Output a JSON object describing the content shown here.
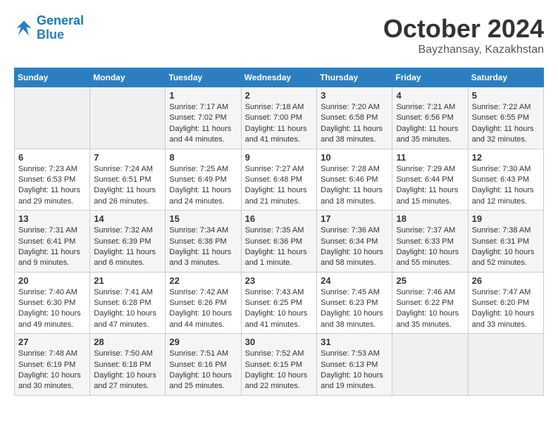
{
  "logo": {
    "line1": "General",
    "line2": "Blue"
  },
  "title": "October 2024",
  "location": "Bayzhansay, Kazakhstan",
  "weekdays": [
    "Sunday",
    "Monday",
    "Tuesday",
    "Wednesday",
    "Thursday",
    "Friday",
    "Saturday"
  ],
  "weeks": [
    [
      {
        "day": "",
        "info": ""
      },
      {
        "day": "",
        "info": ""
      },
      {
        "day": "1",
        "info": "Sunrise: 7:17 AM\nSunset: 7:02 PM\nDaylight: 11 hours and 44 minutes."
      },
      {
        "day": "2",
        "info": "Sunrise: 7:18 AM\nSunset: 7:00 PM\nDaylight: 11 hours and 41 minutes."
      },
      {
        "day": "3",
        "info": "Sunrise: 7:20 AM\nSunset: 6:58 PM\nDaylight: 11 hours and 38 minutes."
      },
      {
        "day": "4",
        "info": "Sunrise: 7:21 AM\nSunset: 6:56 PM\nDaylight: 11 hours and 35 minutes."
      },
      {
        "day": "5",
        "info": "Sunrise: 7:22 AM\nSunset: 6:55 PM\nDaylight: 11 hours and 32 minutes."
      }
    ],
    [
      {
        "day": "6",
        "info": "Sunrise: 7:23 AM\nSunset: 6:53 PM\nDaylight: 11 hours and 29 minutes."
      },
      {
        "day": "7",
        "info": "Sunrise: 7:24 AM\nSunset: 6:51 PM\nDaylight: 11 hours and 26 minutes."
      },
      {
        "day": "8",
        "info": "Sunrise: 7:25 AM\nSunset: 6:49 PM\nDaylight: 11 hours and 24 minutes."
      },
      {
        "day": "9",
        "info": "Sunrise: 7:27 AM\nSunset: 6:48 PM\nDaylight: 11 hours and 21 minutes."
      },
      {
        "day": "10",
        "info": "Sunrise: 7:28 AM\nSunset: 6:46 PM\nDaylight: 11 hours and 18 minutes."
      },
      {
        "day": "11",
        "info": "Sunrise: 7:29 AM\nSunset: 6:44 PM\nDaylight: 11 hours and 15 minutes."
      },
      {
        "day": "12",
        "info": "Sunrise: 7:30 AM\nSunset: 6:43 PM\nDaylight: 11 hours and 12 minutes."
      }
    ],
    [
      {
        "day": "13",
        "info": "Sunrise: 7:31 AM\nSunset: 6:41 PM\nDaylight: 11 hours and 9 minutes."
      },
      {
        "day": "14",
        "info": "Sunrise: 7:32 AM\nSunset: 6:39 PM\nDaylight: 11 hours and 6 minutes."
      },
      {
        "day": "15",
        "info": "Sunrise: 7:34 AM\nSunset: 6:38 PM\nDaylight: 11 hours and 3 minutes."
      },
      {
        "day": "16",
        "info": "Sunrise: 7:35 AM\nSunset: 6:36 PM\nDaylight: 11 hours and 1 minute."
      },
      {
        "day": "17",
        "info": "Sunrise: 7:36 AM\nSunset: 6:34 PM\nDaylight: 10 hours and 58 minutes."
      },
      {
        "day": "18",
        "info": "Sunrise: 7:37 AM\nSunset: 6:33 PM\nDaylight: 10 hours and 55 minutes."
      },
      {
        "day": "19",
        "info": "Sunrise: 7:38 AM\nSunset: 6:31 PM\nDaylight: 10 hours and 52 minutes."
      }
    ],
    [
      {
        "day": "20",
        "info": "Sunrise: 7:40 AM\nSunset: 6:30 PM\nDaylight: 10 hours and 49 minutes."
      },
      {
        "day": "21",
        "info": "Sunrise: 7:41 AM\nSunset: 6:28 PM\nDaylight: 10 hours and 47 minutes."
      },
      {
        "day": "22",
        "info": "Sunrise: 7:42 AM\nSunset: 6:26 PM\nDaylight: 10 hours and 44 minutes."
      },
      {
        "day": "23",
        "info": "Sunrise: 7:43 AM\nSunset: 6:25 PM\nDaylight: 10 hours and 41 minutes."
      },
      {
        "day": "24",
        "info": "Sunrise: 7:45 AM\nSunset: 6:23 PM\nDaylight: 10 hours and 38 minutes."
      },
      {
        "day": "25",
        "info": "Sunrise: 7:46 AM\nSunset: 6:22 PM\nDaylight: 10 hours and 35 minutes."
      },
      {
        "day": "26",
        "info": "Sunrise: 7:47 AM\nSunset: 6:20 PM\nDaylight: 10 hours and 33 minutes."
      }
    ],
    [
      {
        "day": "27",
        "info": "Sunrise: 7:48 AM\nSunset: 6:19 PM\nDaylight: 10 hours and 30 minutes."
      },
      {
        "day": "28",
        "info": "Sunrise: 7:50 AM\nSunset: 6:18 PM\nDaylight: 10 hours and 27 minutes."
      },
      {
        "day": "29",
        "info": "Sunrise: 7:51 AM\nSunset: 6:16 PM\nDaylight: 10 hours and 25 minutes."
      },
      {
        "day": "30",
        "info": "Sunrise: 7:52 AM\nSunset: 6:15 PM\nDaylight: 10 hours and 22 minutes."
      },
      {
        "day": "31",
        "info": "Sunrise: 7:53 AM\nSunset: 6:13 PM\nDaylight: 10 hours and 19 minutes."
      },
      {
        "day": "",
        "info": ""
      },
      {
        "day": "",
        "info": ""
      }
    ]
  ]
}
